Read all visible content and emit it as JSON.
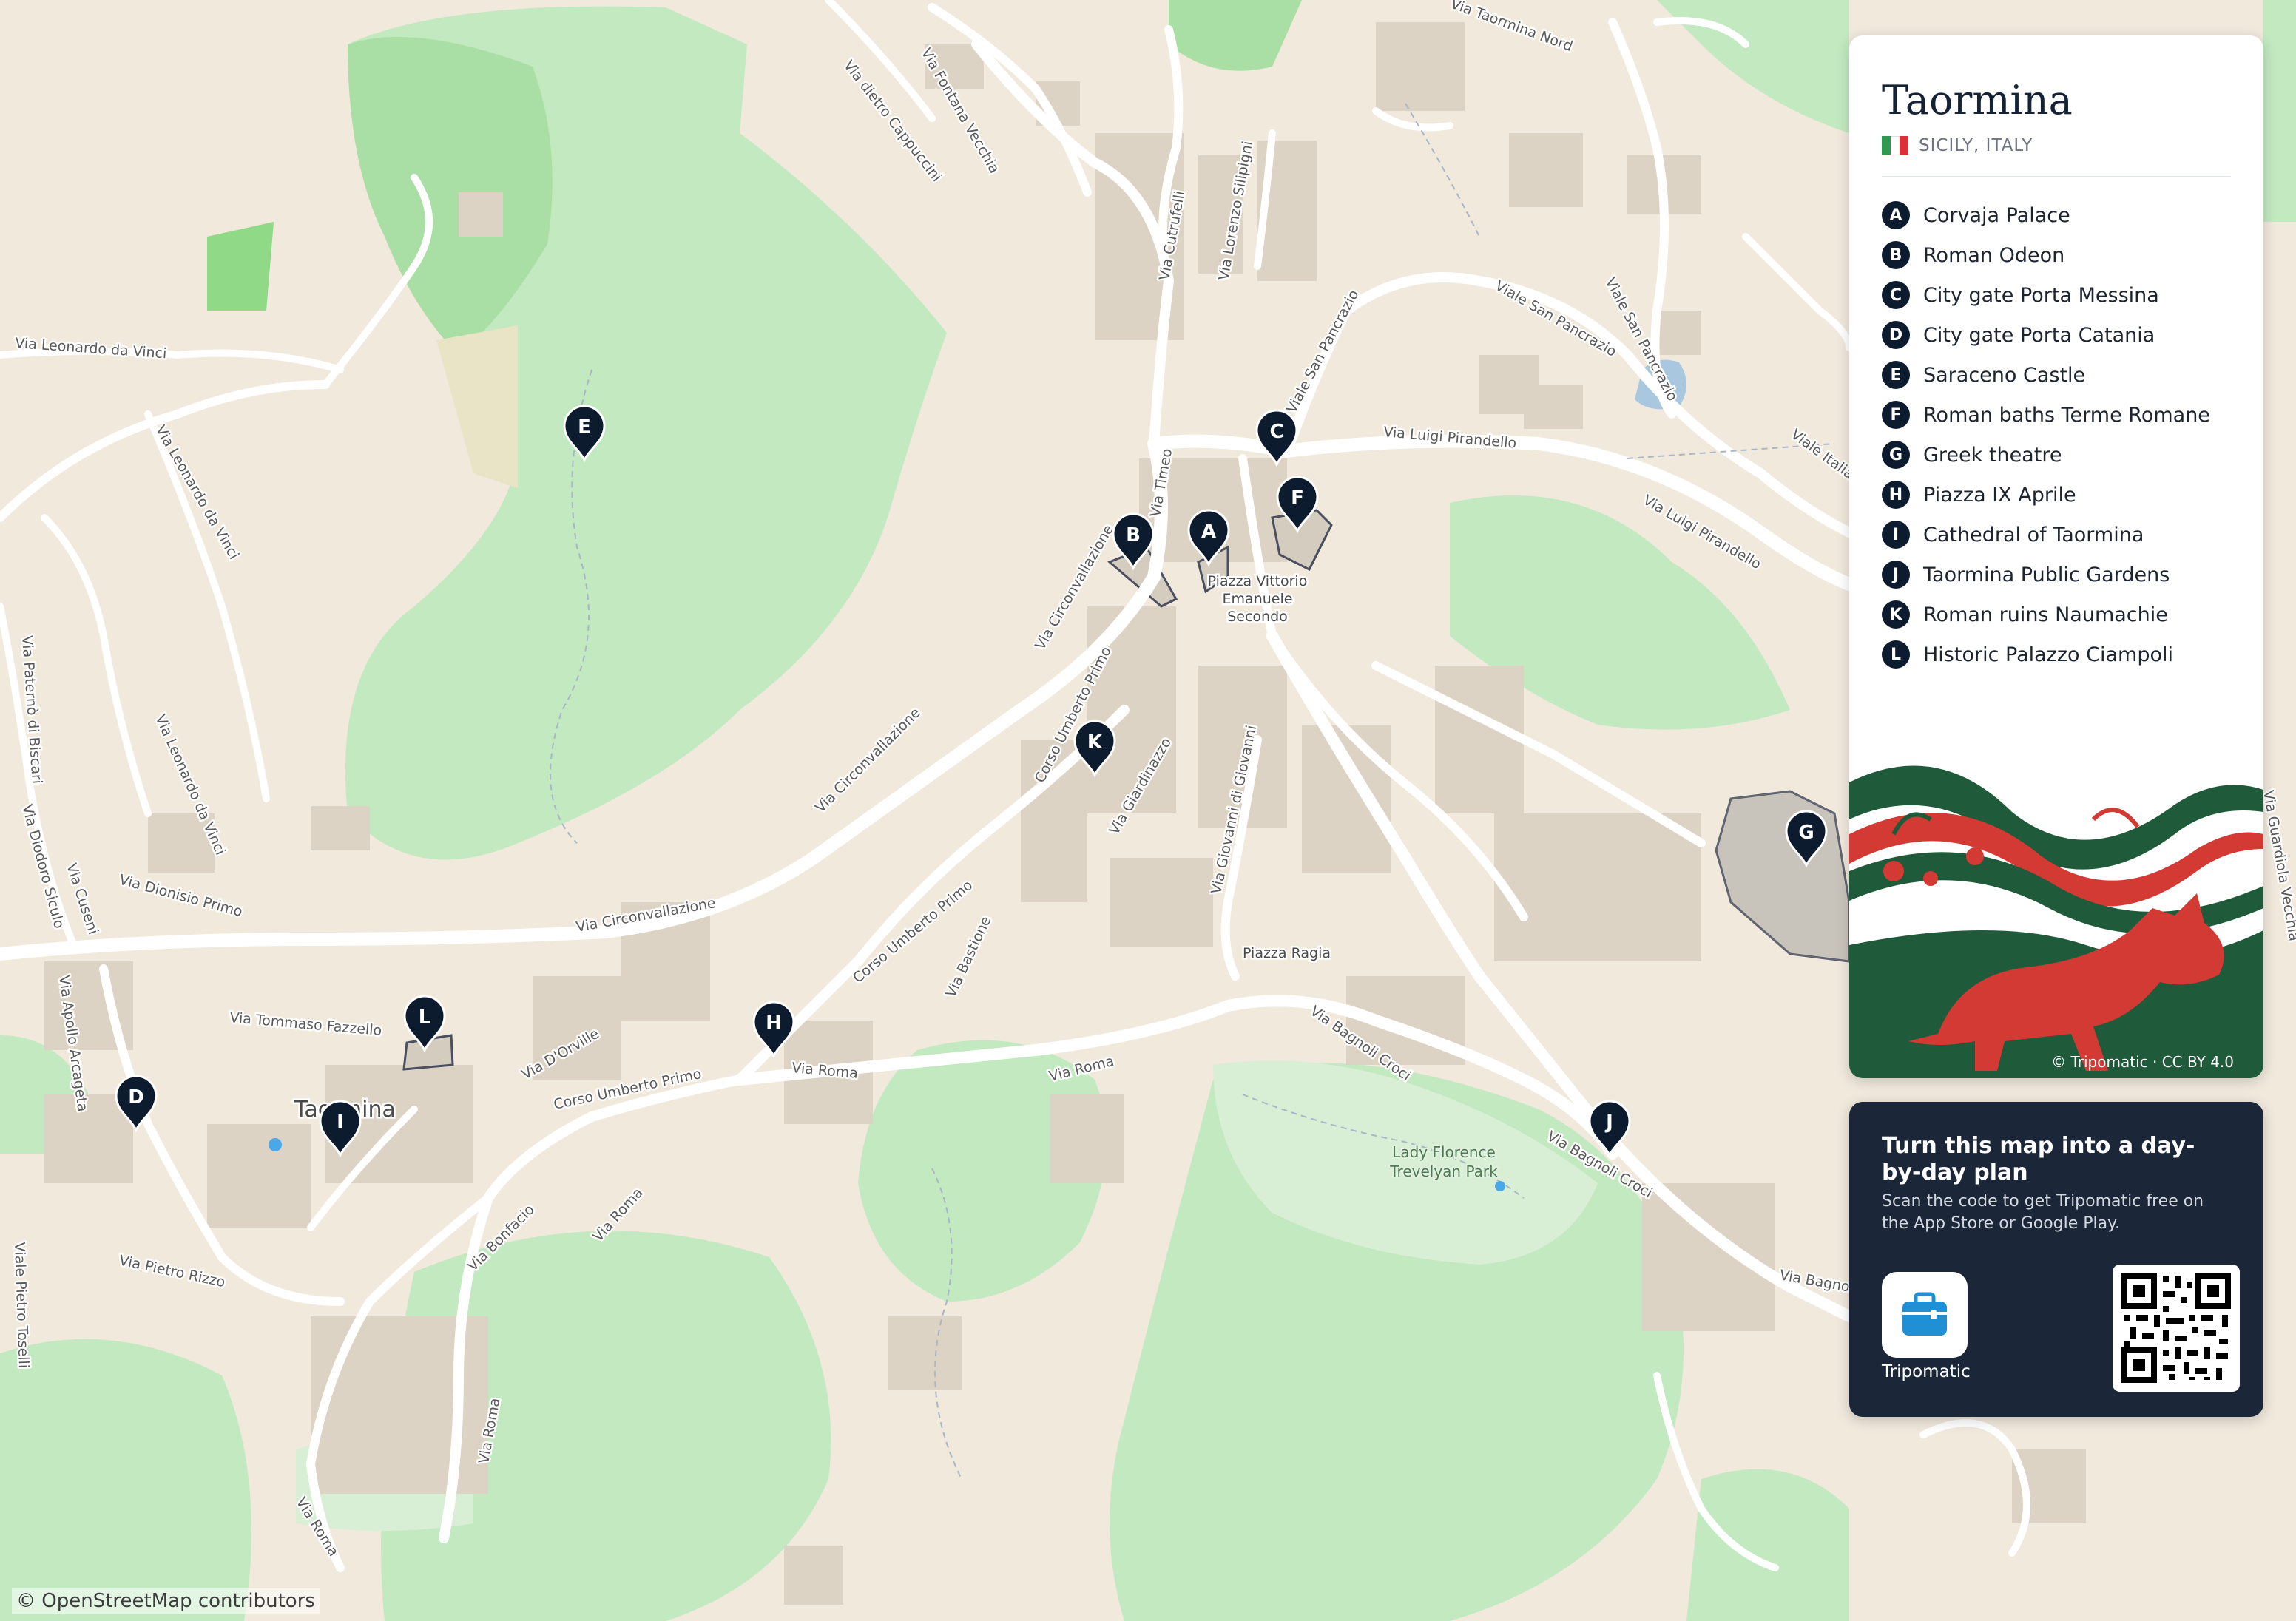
{
  "map": {
    "city_label": "Taormina",
    "attribution": "© OpenStreetMap contributors",
    "streets": [
      "Via Fontana Vecchia",
      "Via dietro Cappuccini",
      "Via Taormina Nord",
      "Via Cutrufelli",
      "Via Lorenzo Silipigni",
      "Viale San Pancrazio",
      "Viale San Pancrazio",
      "Viale San Pancrazio",
      "Via Leonardo da Vinci",
      "Via Leonardo da Vinci",
      "Via Leonardo da Vinci",
      "Via Luigi Pirandello",
      "Via Luigi Pirandello",
      "Via Timeo",
      "Via Circonvallazione",
      "Via Circonvallazione",
      "Via Circonvallazione",
      "Corso Umberto Primo",
      "Corso Umberto Primo",
      "Corso Umberto Primo",
      "Via Giardinazzo",
      "Via Giovanni di Giovanni",
      "Via Bastione",
      "Via Paternò di Biscari",
      "Via Diodoro Siculo",
      "Via Cuseni",
      "Via Dionisio Primo",
      "Via Apollo Arcageta",
      "Via Tommaso Fazzello",
      "Via D'Orville",
      "Via Roma",
      "Via Roma",
      "Via Roma",
      "Via Roma",
      "Via Roma",
      "Via Bagnoli Croci",
      "Via Bagnoli Croci",
      "Via Bagnoli Croci",
      "Via Bonfacio",
      "Via Pietro Rizzo",
      "Viale Pietro Toselli",
      "Viale Italia",
      "Via Guardiola Vecchia"
    ],
    "places": {
      "piazza_vittorio": [
        "Piazza Vittorio",
        "Emanuele",
        "Secondo"
      ],
      "piazza_ragia": "Piazza Ragia",
      "park": [
        "Lady Florence",
        "Trevelyan Park"
      ]
    },
    "pins": [
      "A",
      "B",
      "C",
      "D",
      "E",
      "F",
      "G",
      "H",
      "I",
      "J",
      "K",
      "L"
    ]
  },
  "legend": {
    "title": "Taormina",
    "country": "SICILY, ITALY",
    "items": [
      {
        "letter": "A",
        "name": "Corvaja Palace"
      },
      {
        "letter": "B",
        "name": "Roman Odeon"
      },
      {
        "letter": "C",
        "name": "City gate Porta Messina"
      },
      {
        "letter": "D",
        "name": "City gate Porta Catania"
      },
      {
        "letter": "E",
        "name": "Saraceno Castle"
      },
      {
        "letter": "F",
        "name": "Roman baths Terme Romane"
      },
      {
        "letter": "G",
        "name": "Greek theatre"
      },
      {
        "letter": "H",
        "name": "Piazza IX Aprile"
      },
      {
        "letter": "I",
        "name": "Cathedral of Taormina"
      },
      {
        "letter": "J",
        "name": "Taormina Public Gardens"
      },
      {
        "letter": "K",
        "name": "Roman ruins Naumachie"
      },
      {
        "letter": "L",
        "name": "Historic Palazzo Ciampoli"
      }
    ],
    "art_credit": "© Tripomatic · CC BY 4.0"
  },
  "promo": {
    "title": "Turn this map into a day-by-day plan",
    "body": "Scan the code to get Tripomatic free on the App Store or Google Play.",
    "app_name": "Tripomatic"
  },
  "colors": {
    "land": "#f0e9dc",
    "park": "#a5dca0",
    "forest": "#c0e8c0",
    "building": "#dcd3c4",
    "pin": "#0d1b2e",
    "panel_dark": "#1b2638",
    "flag_green": "#2e9a4f",
    "flag_white": "#ffffff",
    "flag_red": "#d9303a",
    "art_green": "#1f5a3a",
    "art_red": "#d33a33"
  }
}
